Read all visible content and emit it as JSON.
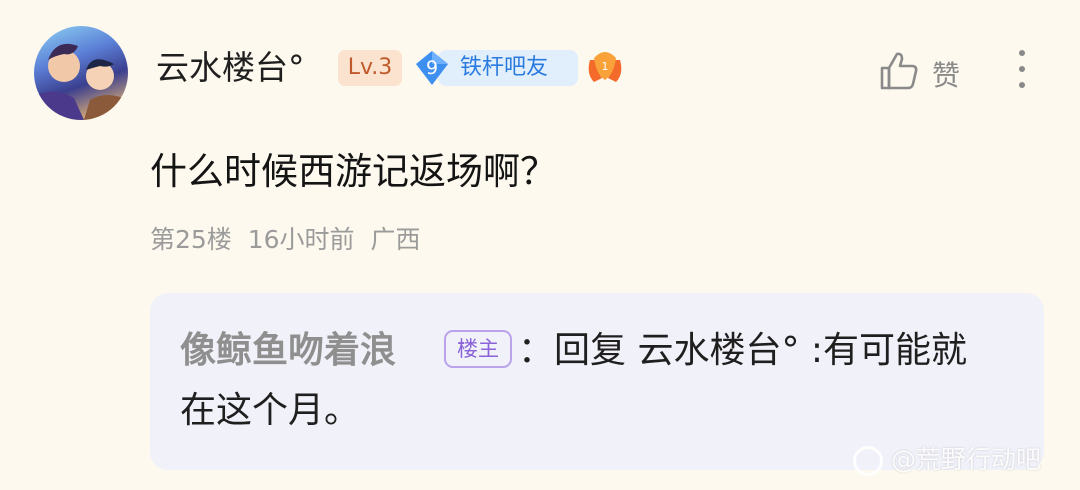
{
  "post": {
    "username": "云水楼台°",
    "level_badge": "Lv.3",
    "fan_level": "9",
    "fan_title": "铁杆吧友",
    "like_label": "赞",
    "content": "什么时候西游记返场啊？",
    "floor": "第25楼",
    "time": "16小时前",
    "location": "广西"
  },
  "reply": {
    "author": "像鲸鱼吻着浪",
    "owner_badge": "楼主",
    "text": "：回复 云水楼台° :有可能就在这个月。"
  },
  "watermark": "@荒野行动吧",
  "colors": {
    "background": "#fdf9ee",
    "reply_bg": "#f1f1f9",
    "level_badge": "#c05a2a",
    "fan_badge": "#2a7be0",
    "owner_badge": "#8a63d8"
  },
  "icons": [
    "avatar",
    "medal-icon",
    "thumbs-up-icon",
    "more-vertical-icon"
  ]
}
